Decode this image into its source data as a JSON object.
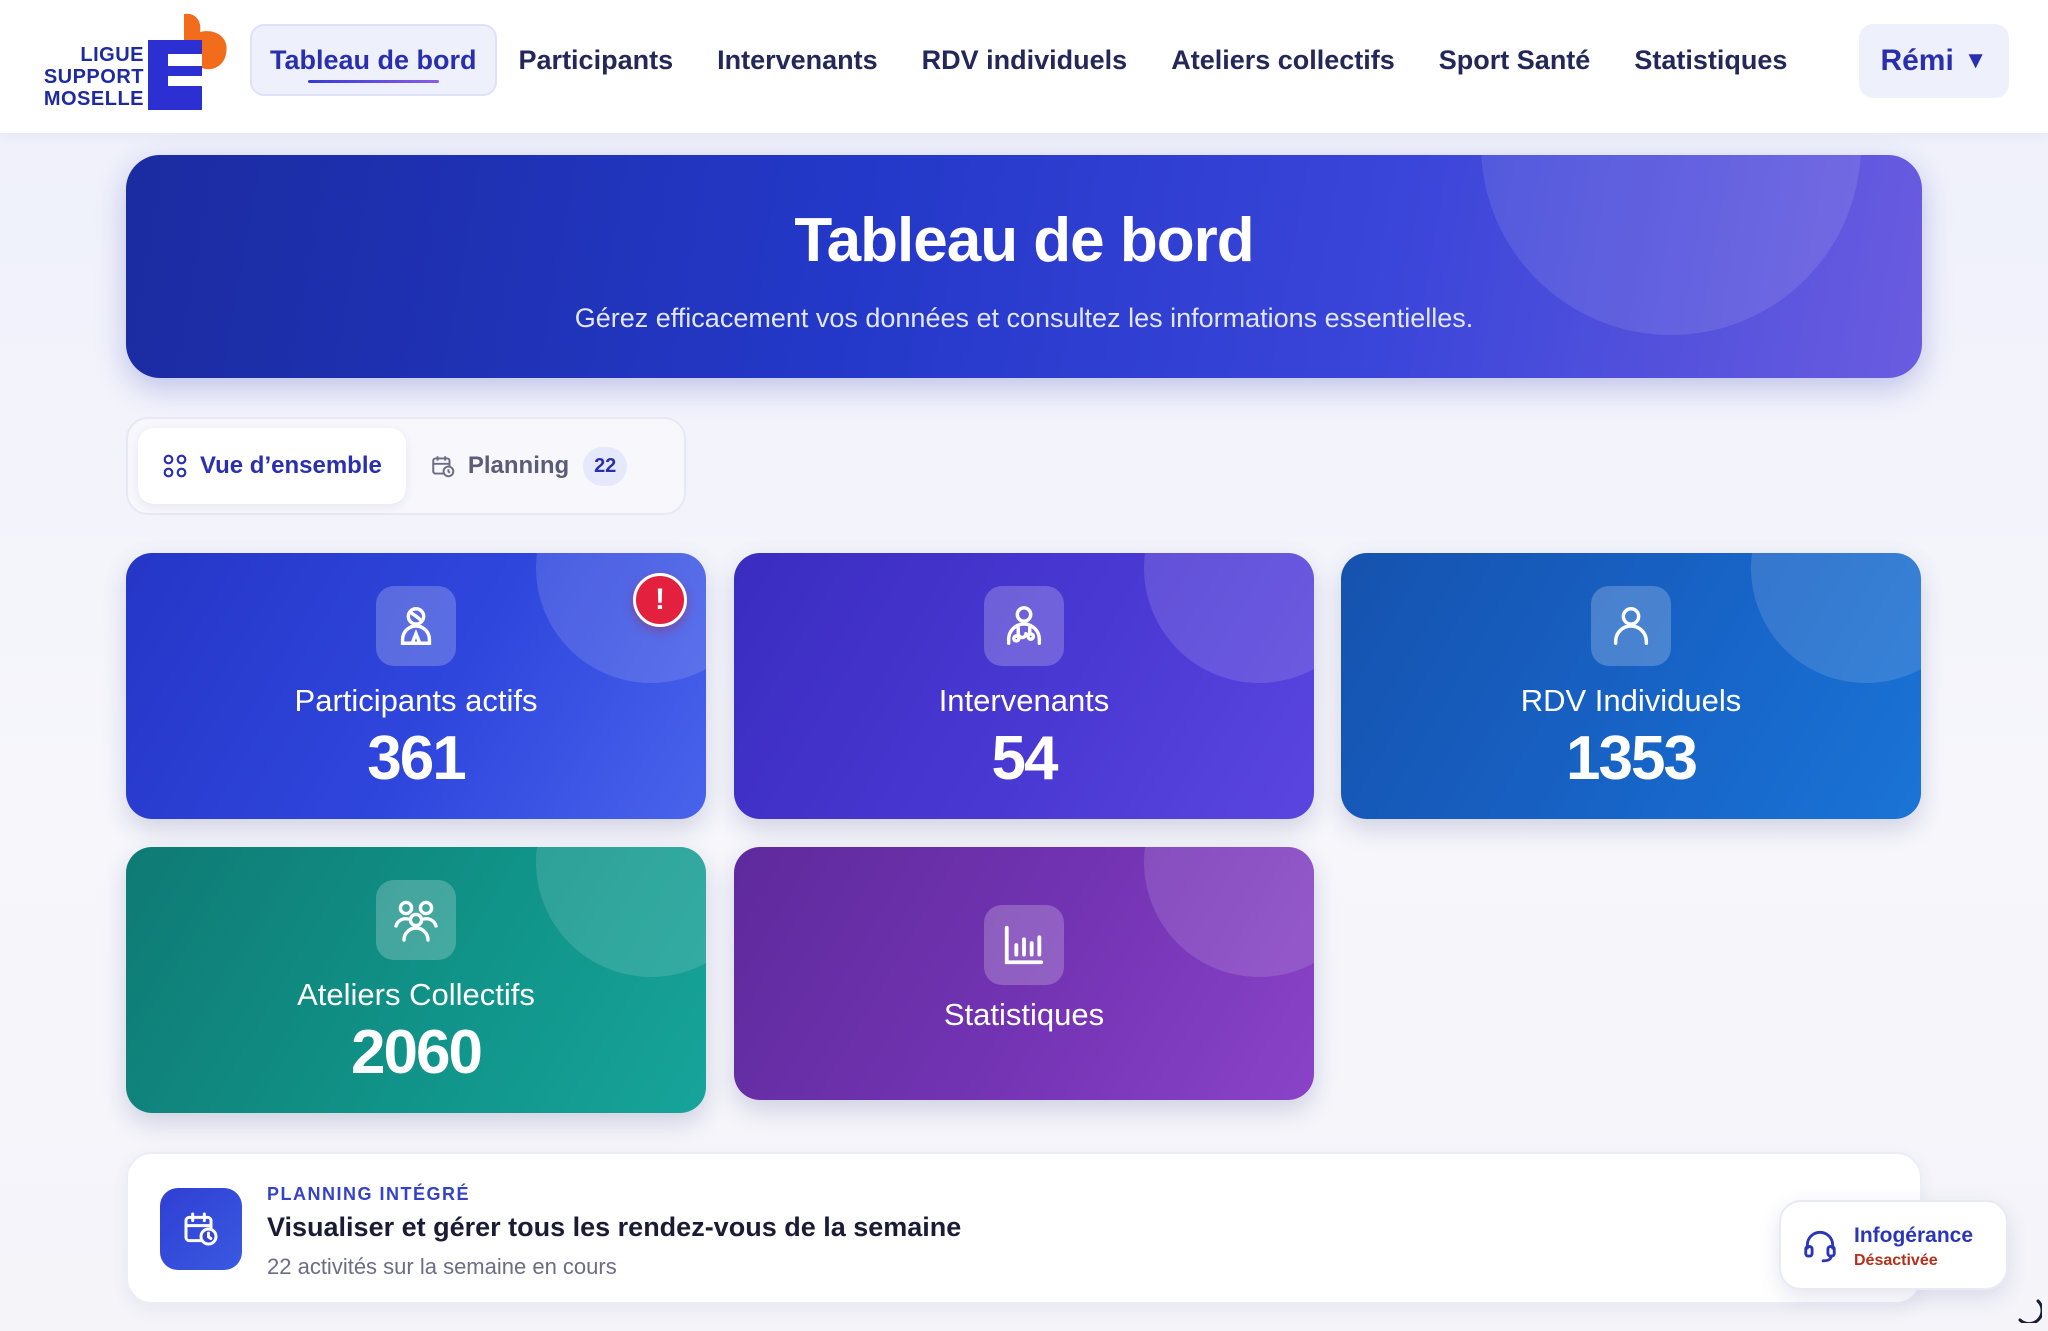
{
  "brand": {
    "logo_text": "LIGUE SUPPORT MOSELLE",
    "colors": {
      "primary": "#2a2fb0",
      "accent_orange": "#f26d1b"
    }
  },
  "nav": {
    "items": [
      {
        "label": "Tableau de bord",
        "active": true
      },
      {
        "label": "Participants",
        "active": false
      },
      {
        "label": "Intervenants",
        "active": false
      },
      {
        "label": "RDV individuels",
        "active": false
      },
      {
        "label": "Ateliers collectifs",
        "active": false
      },
      {
        "label": "Sport Santé",
        "active": false
      },
      {
        "label": "Statistiques",
        "active": false
      }
    ],
    "user": {
      "name": "Rémi",
      "caret": "▼"
    }
  },
  "hero": {
    "title": "Tableau de bord",
    "subtitle": "Gérez efficacement vos données et consultez les informations essentielles."
  },
  "tabs": {
    "overview": {
      "label": "Vue d’ensemble",
      "icon": "grid-icon",
      "active": true
    },
    "planning": {
      "label": "Planning",
      "icon": "calendar-clock-icon",
      "count": "22",
      "active": false
    }
  },
  "cards": {
    "participants": {
      "label": "Participants actifs",
      "value": "361",
      "icon": "user-ribbon-icon",
      "alert": "!"
    },
    "intervenants": {
      "label": "Intervenants",
      "value": "54",
      "icon": "stethoscope-user-icon"
    },
    "rdv": {
      "label": "RDV Individuels",
      "value": "1353",
      "icon": "user-icon"
    },
    "ateliers": {
      "label": "Ateliers Collectifs",
      "value": "2060",
      "icon": "users-group-icon"
    },
    "stats": {
      "label": "Statistiques",
      "icon": "bar-chart-icon"
    }
  },
  "planning_banner": {
    "kicker": "PLANNING INTÉGRÉ",
    "title": "Visualiser et gérer tous les rendez-vous de la semaine",
    "subtitle": "22 activités sur la semaine en cours",
    "icon": "calendar-clock-icon"
  },
  "infogerance": {
    "title": "Infogérance",
    "status": "Désactivée",
    "icon": "headset-icon"
  }
}
